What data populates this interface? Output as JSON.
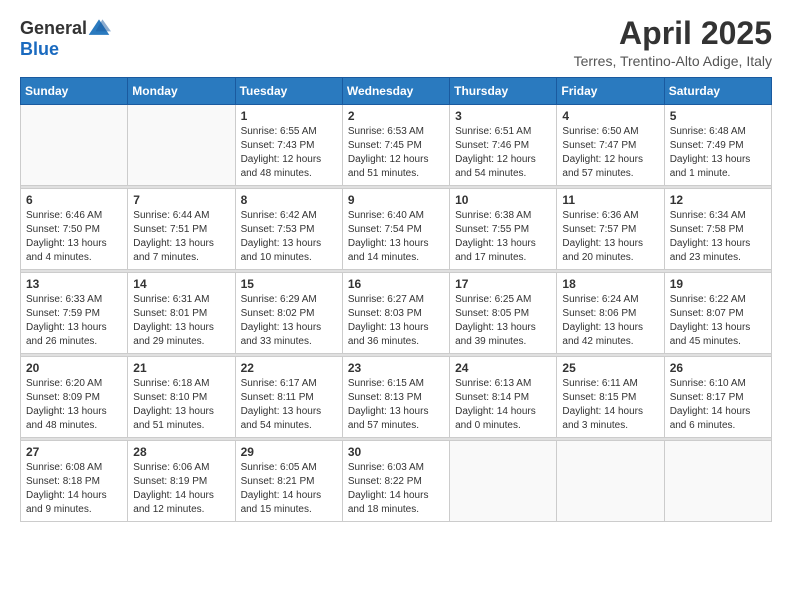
{
  "logo": {
    "text_general": "General",
    "text_blue": "Blue"
  },
  "title": "April 2025",
  "subtitle": "Terres, Trentino-Alto Adige, Italy",
  "days_of_week": [
    "Sunday",
    "Monday",
    "Tuesday",
    "Wednesday",
    "Thursday",
    "Friday",
    "Saturday"
  ],
  "weeks": [
    [
      {
        "day": "",
        "sunrise": "",
        "sunset": "",
        "daylight": ""
      },
      {
        "day": "",
        "sunrise": "",
        "sunset": "",
        "daylight": ""
      },
      {
        "day": "1",
        "sunrise": "Sunrise: 6:55 AM",
        "sunset": "Sunset: 7:43 PM",
        "daylight": "Daylight: 12 hours and 48 minutes."
      },
      {
        "day": "2",
        "sunrise": "Sunrise: 6:53 AM",
        "sunset": "Sunset: 7:45 PM",
        "daylight": "Daylight: 12 hours and 51 minutes."
      },
      {
        "day": "3",
        "sunrise": "Sunrise: 6:51 AM",
        "sunset": "Sunset: 7:46 PM",
        "daylight": "Daylight: 12 hours and 54 minutes."
      },
      {
        "day": "4",
        "sunrise": "Sunrise: 6:50 AM",
        "sunset": "Sunset: 7:47 PM",
        "daylight": "Daylight: 12 hours and 57 minutes."
      },
      {
        "day": "5",
        "sunrise": "Sunrise: 6:48 AM",
        "sunset": "Sunset: 7:49 PM",
        "daylight": "Daylight: 13 hours and 1 minute."
      }
    ],
    [
      {
        "day": "6",
        "sunrise": "Sunrise: 6:46 AM",
        "sunset": "Sunset: 7:50 PM",
        "daylight": "Daylight: 13 hours and 4 minutes."
      },
      {
        "day": "7",
        "sunrise": "Sunrise: 6:44 AM",
        "sunset": "Sunset: 7:51 PM",
        "daylight": "Daylight: 13 hours and 7 minutes."
      },
      {
        "day": "8",
        "sunrise": "Sunrise: 6:42 AM",
        "sunset": "Sunset: 7:53 PM",
        "daylight": "Daylight: 13 hours and 10 minutes."
      },
      {
        "day": "9",
        "sunrise": "Sunrise: 6:40 AM",
        "sunset": "Sunset: 7:54 PM",
        "daylight": "Daylight: 13 hours and 14 minutes."
      },
      {
        "day": "10",
        "sunrise": "Sunrise: 6:38 AM",
        "sunset": "Sunset: 7:55 PM",
        "daylight": "Daylight: 13 hours and 17 minutes."
      },
      {
        "day": "11",
        "sunrise": "Sunrise: 6:36 AM",
        "sunset": "Sunset: 7:57 PM",
        "daylight": "Daylight: 13 hours and 20 minutes."
      },
      {
        "day": "12",
        "sunrise": "Sunrise: 6:34 AM",
        "sunset": "Sunset: 7:58 PM",
        "daylight": "Daylight: 13 hours and 23 minutes."
      }
    ],
    [
      {
        "day": "13",
        "sunrise": "Sunrise: 6:33 AM",
        "sunset": "Sunset: 7:59 PM",
        "daylight": "Daylight: 13 hours and 26 minutes."
      },
      {
        "day": "14",
        "sunrise": "Sunrise: 6:31 AM",
        "sunset": "Sunset: 8:01 PM",
        "daylight": "Daylight: 13 hours and 29 minutes."
      },
      {
        "day": "15",
        "sunrise": "Sunrise: 6:29 AM",
        "sunset": "Sunset: 8:02 PM",
        "daylight": "Daylight: 13 hours and 33 minutes."
      },
      {
        "day": "16",
        "sunrise": "Sunrise: 6:27 AM",
        "sunset": "Sunset: 8:03 PM",
        "daylight": "Daylight: 13 hours and 36 minutes."
      },
      {
        "day": "17",
        "sunrise": "Sunrise: 6:25 AM",
        "sunset": "Sunset: 8:05 PM",
        "daylight": "Daylight: 13 hours and 39 minutes."
      },
      {
        "day": "18",
        "sunrise": "Sunrise: 6:24 AM",
        "sunset": "Sunset: 8:06 PM",
        "daylight": "Daylight: 13 hours and 42 minutes."
      },
      {
        "day": "19",
        "sunrise": "Sunrise: 6:22 AM",
        "sunset": "Sunset: 8:07 PM",
        "daylight": "Daylight: 13 hours and 45 minutes."
      }
    ],
    [
      {
        "day": "20",
        "sunrise": "Sunrise: 6:20 AM",
        "sunset": "Sunset: 8:09 PM",
        "daylight": "Daylight: 13 hours and 48 minutes."
      },
      {
        "day": "21",
        "sunrise": "Sunrise: 6:18 AM",
        "sunset": "Sunset: 8:10 PM",
        "daylight": "Daylight: 13 hours and 51 minutes."
      },
      {
        "day": "22",
        "sunrise": "Sunrise: 6:17 AM",
        "sunset": "Sunset: 8:11 PM",
        "daylight": "Daylight: 13 hours and 54 minutes."
      },
      {
        "day": "23",
        "sunrise": "Sunrise: 6:15 AM",
        "sunset": "Sunset: 8:13 PM",
        "daylight": "Daylight: 13 hours and 57 minutes."
      },
      {
        "day": "24",
        "sunrise": "Sunrise: 6:13 AM",
        "sunset": "Sunset: 8:14 PM",
        "daylight": "Daylight: 14 hours and 0 minutes."
      },
      {
        "day": "25",
        "sunrise": "Sunrise: 6:11 AM",
        "sunset": "Sunset: 8:15 PM",
        "daylight": "Daylight: 14 hours and 3 minutes."
      },
      {
        "day": "26",
        "sunrise": "Sunrise: 6:10 AM",
        "sunset": "Sunset: 8:17 PM",
        "daylight": "Daylight: 14 hours and 6 minutes."
      }
    ],
    [
      {
        "day": "27",
        "sunrise": "Sunrise: 6:08 AM",
        "sunset": "Sunset: 8:18 PM",
        "daylight": "Daylight: 14 hours and 9 minutes."
      },
      {
        "day": "28",
        "sunrise": "Sunrise: 6:06 AM",
        "sunset": "Sunset: 8:19 PM",
        "daylight": "Daylight: 14 hours and 12 minutes."
      },
      {
        "day": "29",
        "sunrise": "Sunrise: 6:05 AM",
        "sunset": "Sunset: 8:21 PM",
        "daylight": "Daylight: 14 hours and 15 minutes."
      },
      {
        "day": "30",
        "sunrise": "Sunrise: 6:03 AM",
        "sunset": "Sunset: 8:22 PM",
        "daylight": "Daylight: 14 hours and 18 minutes."
      },
      {
        "day": "",
        "sunrise": "",
        "sunset": "",
        "daylight": ""
      },
      {
        "day": "",
        "sunrise": "",
        "sunset": "",
        "daylight": ""
      },
      {
        "day": "",
        "sunrise": "",
        "sunset": "",
        "daylight": ""
      }
    ]
  ]
}
